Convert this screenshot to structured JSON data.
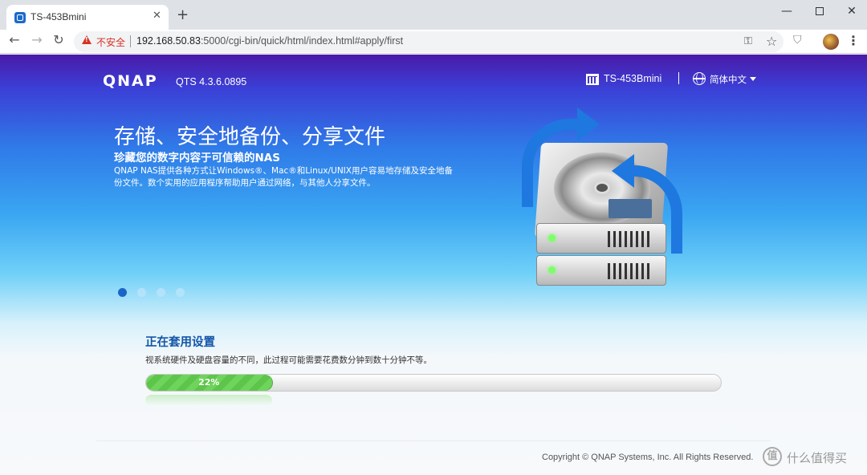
{
  "browser": {
    "tab_title": "TS-453Bmini",
    "tab_close": "✕",
    "new_tab": "+",
    "window_controls": {
      "minimize": "—",
      "close": "✕"
    },
    "nav": {
      "back": "←",
      "forward": "→",
      "reload": "↻"
    },
    "security_label": "不安全",
    "url_host": "192.168.50.83",
    "url_rest": ":5000/cgi-bin/quick/html/index.html#apply/first",
    "menu": "⋮"
  },
  "header": {
    "logo": "QNAP",
    "qts_version": "QTS 4.3.6.0895",
    "device_name": "TS-453Bmini",
    "language": "简体中文"
  },
  "hero": {
    "title": "存储、安全地备份、分享文件",
    "subtitle": "珍藏您的数字内容于可信赖的NAS",
    "description": "QNAP NAS提供各种方式让Windows®、Mac®和Linux/UNIX用户容易地存储及安全地备份文件。数个实用的应用程序帮助用户通过网络，与其他人分享文件。",
    "slide_count": 4,
    "active_slide": 1
  },
  "progress": {
    "title": "正在套用设置",
    "description": "视系统硬件及硬盘容量的不同，此过程可能需要花费数分钟到数十分钟不等。",
    "percent_label": "22%",
    "percent": 22
  },
  "footer": {
    "copyright": "Copyright © QNAP Systems, Inc. All Rights Reserved.",
    "watermark_mark": "值",
    "watermark_text": "什么值得买"
  },
  "colors": {
    "progress_fill": "#6fd45b",
    "active_dot": "#1b64c7",
    "progress_title": "#1456a8",
    "insecure": "#d93025"
  }
}
